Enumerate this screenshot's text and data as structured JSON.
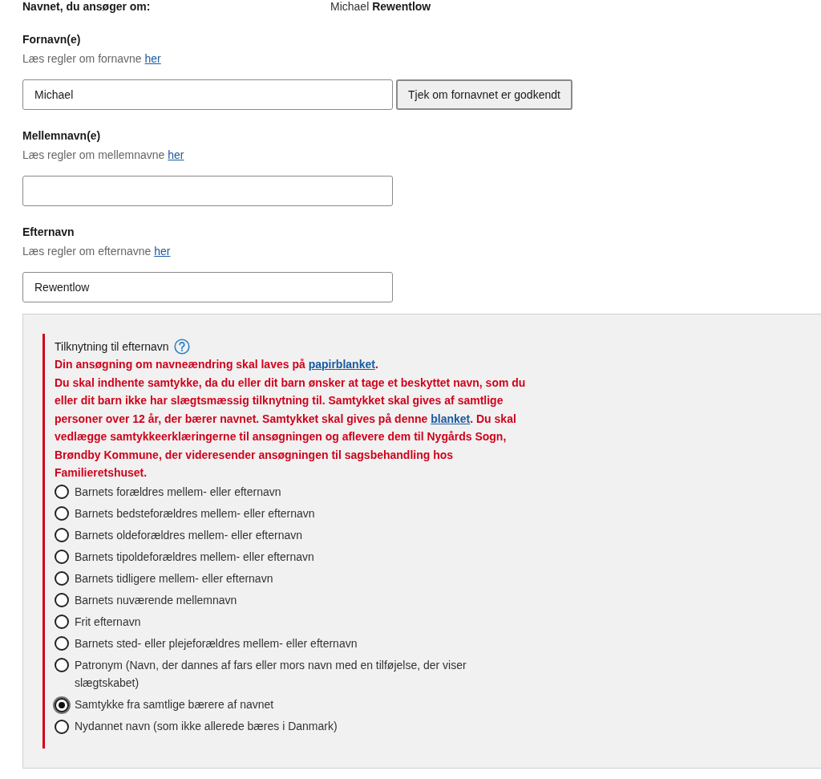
{
  "summary": {
    "label": "Navnet, du ansøger om:",
    "value": "Michael **Rewentlow**"
  },
  "fields": [
    {
      "label": "Fornavn(e)",
      "hint": "Læs regler om fornavne",
      "hint_link": "her",
      "value": "Michael",
      "button": "Tjek om fornavnet er godkendt"
    },
    {
      "label": "Mellemnavn(e)",
      "hint": "Læs regler om mellemnavne",
      "hint_link": "her"
    },
    {
      "label": "Efternavn",
      "hint": "Læs regler om efternavne",
      "hint_link": "her",
      "value": "Rewentlow"
    }
  ],
  "panel": {
    "title": "Tilknytning til efternavn",
    "errors": [
      {
        "before": "Din ansøgning om navneændring skal laves på ",
        "link": "papirblanket",
        "after": "."
      },
      {
        "before": "Du skal indhente samtykke, da du eller dit barn ønsker at tage et beskyttet navn, som du eller dit barn ikke har slægtsmæssig tilknytning til. Samtykket skal gives af samtlige personer over 12 år, der bærer navnet. Samtykket skal gives på denne ",
        "link": "blanket",
        "after": ". Du skal vedlægge samtykkeerklæringerne til ansøgningen og aflevere dem til Nygårds Sogn, Brøndby Kommune, der videresender ansøgningen til sagsbehandling hos Familieretshuset."
      }
    ],
    "options": [
      {
        "label": "Barnets forældres mellem- eller efternavn",
        "selected": false
      },
      {
        "label": "Barnets bedsteforældres mellem- eller efternavn",
        "selected": false
      },
      {
        "label": "Barnets oldeforældres mellem- eller efternavn",
        "selected": false
      },
      {
        "label": "Barnets tipoldeforældres mellem- eller efternavn",
        "selected": false
      },
      {
        "label": "Barnets tidligere mellem- eller efternavn",
        "selected": false
      },
      {
        "label": "Barnets nuværende mellemnavn",
        "selected": false
      },
      {
        "label": "Frit efternavn",
        "selected": false
      },
      {
        "label": "Barnets sted- eller plejeforældres mellem- eller efternavn",
        "selected": false
      },
      {
        "label": "Patronym (Navn, der dannes af fars eller mors navn med en tilføjelse, der viser slægtskabet)",
        "selected": false
      },
      {
        "label": "Samtykke fra samtlige bærere af navnet",
        "selected": true
      },
      {
        "label": "Nydannet navn (som ikke allerede bæres i Danmark)",
        "selected": false
      }
    ]
  }
}
